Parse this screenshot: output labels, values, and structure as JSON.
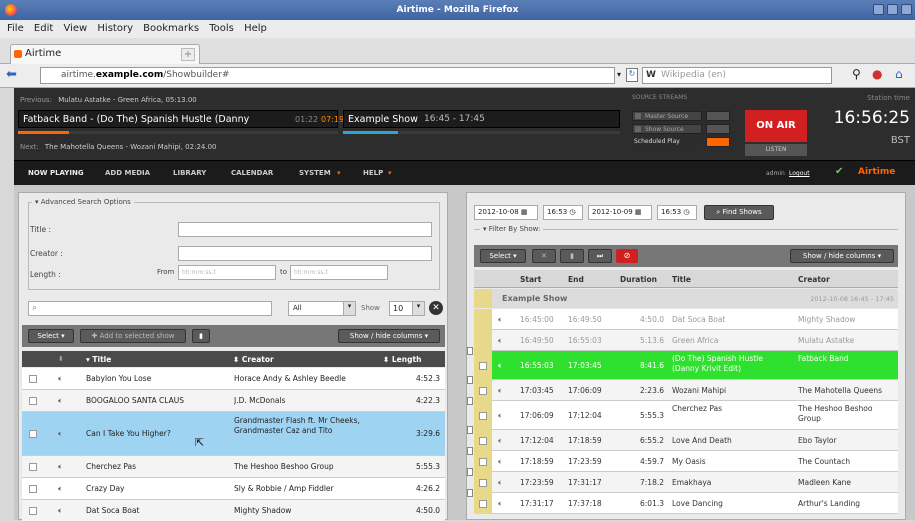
{
  "window": {
    "title": "Airtime - Mozilla Firefox"
  },
  "menu": [
    "File",
    "Edit",
    "View",
    "History",
    "Bookmarks",
    "Tools",
    "Help"
  ],
  "tab": {
    "title": "Airtime",
    "new_tab": "+"
  },
  "nav": {
    "url_prefix": "airtime.",
    "url_domain": "example.com",
    "url_path": "/Showbuilder#",
    "search_placeholder": "Wikipedia (en)",
    "search_engine": "W"
  },
  "player": {
    "previous_label": "Previous:",
    "previous": "Mulatu Astatke - Green Africa, 05:13.00",
    "current_track": "Fatback Band - (Do The) Spanish Hustle (Danny",
    "elapsed": "01:22",
    "remaining": "07:19",
    "next_label": "Next:",
    "next": "The Mahotella Queens - Wozani Mahipi, 02:24.00",
    "show": "Example Show",
    "show_time": "16:45 - 17:45",
    "source_streams": "SOURCE STREAMS",
    "master_source": "Master Source",
    "show_source": "Show Source",
    "scheduled_play": "Scheduled Play",
    "on_air": "ON AIR",
    "listen": "LISTEN",
    "station_time_label": "Station time",
    "time": "16:56:25",
    "tz": "BST"
  },
  "mainnav": {
    "items": [
      "NOW PLAYING",
      "ADD MEDIA",
      "LIBRARY",
      "CALENDAR",
      "SYSTEM",
      "HELP"
    ],
    "user": "admin",
    "logout": "Logout",
    "brand": "Airtime"
  },
  "library": {
    "adv_search": "Advanced Search Options",
    "title_label": "Title :",
    "creator_label": "Creator :",
    "length_label": "Length :",
    "from_label": "From",
    "to_label": "to",
    "from_placeholder": "hh:mm:ss.t",
    "to_placeholder": "hh:mm:ss.t",
    "filter_all": "All",
    "show_label": "Show",
    "show_count": "10",
    "select": "Select",
    "add_to_show": "Add to selected show",
    "show_hide": "Show / hide columns",
    "columns": [
      "Title",
      "Creator",
      "Length"
    ],
    "rows": [
      {
        "title": "Babylon You Lose",
        "creator": "Horace Andy & Ashley Beedle",
        "length": "4:52.3"
      },
      {
        "title": "BOOGALOO SANTA CLAUS",
        "creator": "J.D. McDonals",
        "length": "4:22.3"
      },
      {
        "title": "Can I Take You Higher?",
        "creator": "Grandmaster Flash ft. Mr Cheeks, Grandmaster Caz and Tito",
        "length": "3:29.6"
      },
      {
        "title": "Cherchez Pas",
        "creator": "The Heshoo Beshoo Group",
        "length": "5:55.3"
      },
      {
        "title": "Crazy Day",
        "creator": "Sly & Robbie / Amp Fiddler",
        "length": "4:26.2"
      },
      {
        "title": "Dat Soca Boat",
        "creator": "Mighty Shadow",
        "length": "4:50.0"
      }
    ]
  },
  "builder": {
    "date_from": "2012-10-08",
    "time_from": "16:53",
    "date_to": "2012-10-09",
    "time_to": "16:53",
    "find_shows": "Find Shows",
    "filter_by_show": "Filter By Show:",
    "select": "Select",
    "show_hide": "Show / hide columns",
    "columns": [
      "Start",
      "End",
      "Duration",
      "Title",
      "Creator"
    ],
    "show_name": "Example Show",
    "show_range": "2012-10-08 16:45 - 17:45",
    "rows": [
      {
        "start": "16:45:00",
        "end": "16:49:50",
        "duration": "4:50.0",
        "title": "Dat Soca Boat",
        "creator": "Mighty Shadow",
        "state": "past"
      },
      {
        "start": "16:49:50",
        "end": "16:55:03",
        "duration": "5:13.6",
        "title": "Green Africa",
        "creator": "Mulatu Astatke",
        "state": "past"
      },
      {
        "start": "16:55:03",
        "end": "17:03:45",
        "duration": "8:41.6",
        "title": "(Do The) Spanish Hustle (Danny Krivit Edit)",
        "creator": "Fatback Band",
        "state": "playing"
      },
      {
        "start": "17:03:45",
        "end": "17:06:09",
        "duration": "2:23.6",
        "title": "Wozani Mahipi",
        "creator": "The Mahotella Queens",
        "state": "future"
      },
      {
        "start": "17:06:09",
        "end": "17:12:04",
        "duration": "5:55.3",
        "title": "Cherchez Pas",
        "creator": "The Heshoo Beshoo Group",
        "state": "future"
      },
      {
        "start": "17:12:04",
        "end": "17:18:59",
        "duration": "6:55.2",
        "title": "Love And Death",
        "creator": "Ebo Taylor",
        "state": "future"
      },
      {
        "start": "17:18:59",
        "end": "17:23:59",
        "duration": "4:59.7",
        "title": "My Oasis",
        "creator": "The Countach",
        "state": "future"
      },
      {
        "start": "17:23:59",
        "end": "17:31:17",
        "duration": "7:18.2",
        "title": "Emakhaya",
        "creator": "Madleen Kane",
        "state": "future"
      },
      {
        "start": "17:31:17",
        "end": "17:37:18",
        "duration": "6:01.3",
        "title": "Love Dancing",
        "creator": "Arthur's Landing",
        "state": "future"
      }
    ]
  },
  "colors": {
    "accent": "#ff6600",
    "on_air": "#d21f1f",
    "playing": "#2fe02f",
    "selected": "#9fd3f2",
    "header": "#2d2d2d"
  }
}
